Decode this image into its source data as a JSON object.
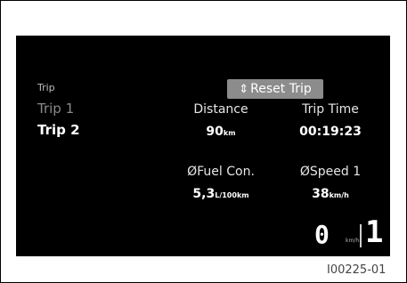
{
  "menu": {
    "section_title": "Trip",
    "items": [
      {
        "label": "Trip 1",
        "selected": false
      },
      {
        "label": "Trip 2",
        "selected": true
      }
    ]
  },
  "reset_button": {
    "icon": "chevron-up-down-icon",
    "label": "Reset Trip"
  },
  "stats": {
    "distance": {
      "label": "Distance",
      "value": "90",
      "unit": "km"
    },
    "trip_time": {
      "label": "Trip Time",
      "value": "00:19:23"
    },
    "fuel": {
      "label": "ØFuel Con.",
      "value": "5,3",
      "unit": "L/100km"
    },
    "speed_avg": {
      "label": "ØSpeed 1",
      "value": "38",
      "unit": "km/h"
    }
  },
  "status": {
    "speed": "0",
    "speed_unit": "km/h",
    "gear": "1"
  },
  "figure_id": "I00225-01",
  "colors": {
    "screen_bg": "#000000",
    "button_bg": "#8c8c8c",
    "text": "#ffffff",
    "inactive_text": "#8a8a8a"
  }
}
